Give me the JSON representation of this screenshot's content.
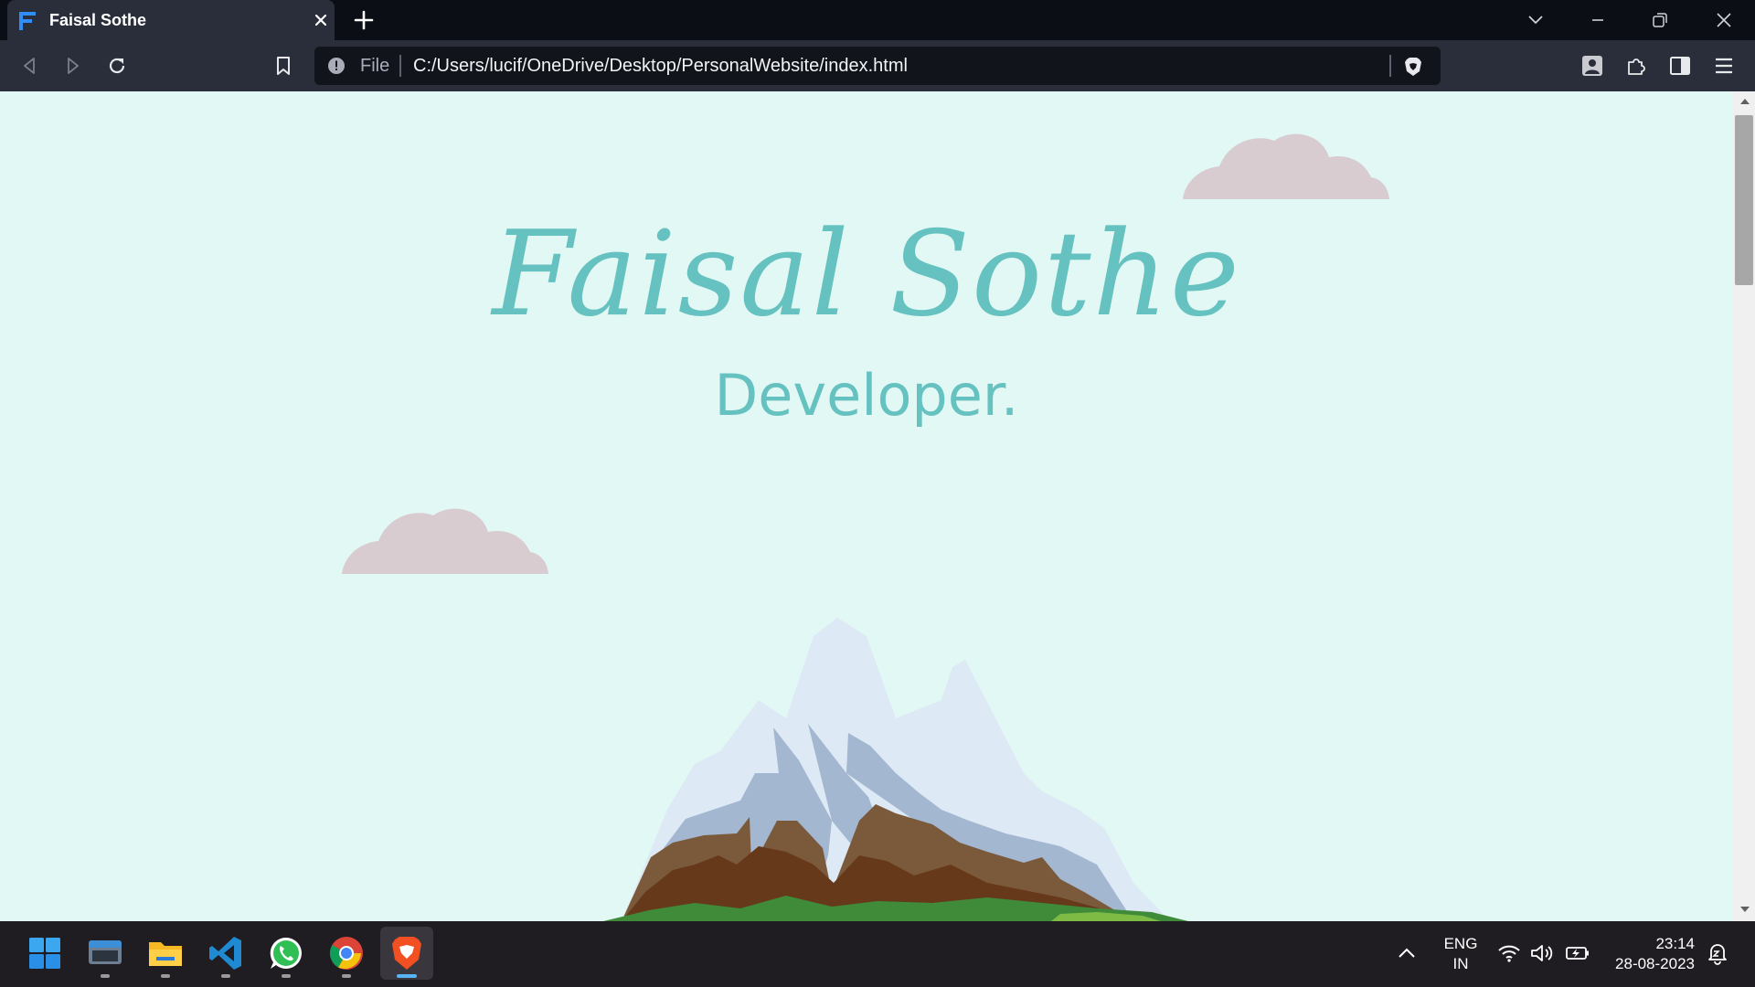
{
  "window": {
    "tab": {
      "title": "Faisal Sothe",
      "favicon": "faisal-f-logo-icon"
    },
    "controls": [
      "tab-search-icon",
      "minimize-icon",
      "restore-icon",
      "close-icon"
    ]
  },
  "toolbar": {
    "icons": [
      "back-icon",
      "forward-icon",
      "reload-icon",
      "bookmark-icon",
      "profile-icon",
      "extensions-icon",
      "sidebar-icon",
      "menu-icon"
    ],
    "url": {
      "scheme_label": "File",
      "text": "C:/Users/lucif/OneDrive/Desktop/PersonalWebsite/index.html",
      "info_icon": "info-icon",
      "shield_icon": "brave-shield-icon"
    }
  },
  "page": {
    "name": "Faisal Sothe",
    "role": "Developer.",
    "colors": {
      "background": "#e2f8f4",
      "accent": "#66c2c0",
      "cloud": "#d9ccd1"
    }
  },
  "taskbar": {
    "apps": [
      {
        "name": "start-icon"
      },
      {
        "name": "terminal-icon"
      },
      {
        "name": "file-explorer-icon"
      },
      {
        "name": "vscode-icon"
      },
      {
        "name": "whatsapp-icon"
      },
      {
        "name": "chrome-icon"
      },
      {
        "name": "brave-icon",
        "active": true
      }
    ],
    "tray": {
      "language_line1": "ENG",
      "language_line2": "IN",
      "time": "23:14",
      "date": "28-08-2023"
    }
  }
}
